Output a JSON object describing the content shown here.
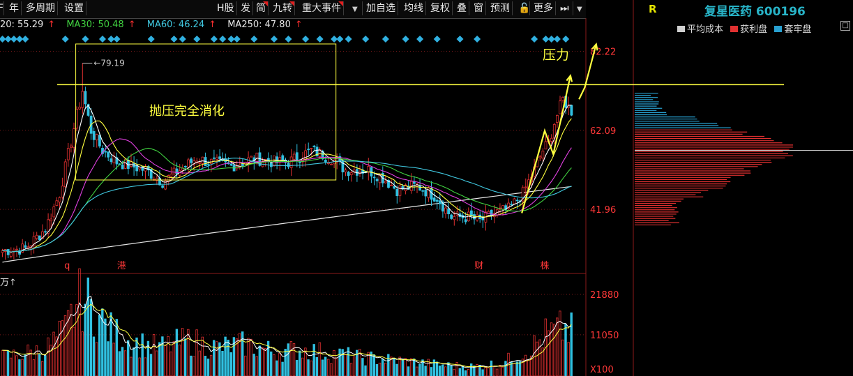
{
  "toolbar": {
    "items": [
      "年",
      "多周期",
      "设置",
      "H股",
      "发",
      "简",
      "九转",
      "重大事件",
      "加自选",
      "均线",
      "复权",
      "叠",
      "窗",
      "预测",
      "更多"
    ],
    "first_fragment": "F"
  },
  "ma_legend": {
    "items": [
      {
        "label": "20: 55.29",
        "color": "#e6e6e6"
      },
      {
        "label": "MA30: 50.48",
        "color": "#40d040"
      },
      {
        "label": "MA60: 46.24",
        "color": "#40c8e0"
      },
      {
        "label": "MA250: 47.80",
        "color": "#e6e6e6"
      }
    ],
    "up_arrow": "↑"
  },
  "volume_label": "万↑",
  "header_right": {
    "r": "R",
    "stock": "复星医药 600196"
  },
  "legend2": {
    "items": [
      {
        "label": "平均成本",
        "color": "#d0d0d0"
      },
      {
        "label": "获利盘",
        "color": "#e03030"
      },
      {
        "label": "套牢盘",
        "color": "#28a0d0"
      }
    ]
  },
  "annotations": {
    "digest": "抛压完全消化",
    "pressure": "压力",
    "peak_label": "79.19"
  },
  "colors": {
    "up": "#e03030",
    "down": "#30c0e0",
    "annot": "#ffff40",
    "axis_text": "#ff3838"
  },
  "chart_data": [
    {
      "type": "line",
      "title": "",
      "price_axis_ticks": [
        82.22,
        62.09,
        41.96
      ],
      "ylim": [
        26.0,
        85.5
      ],
      "bar_count": 200,
      "peak_high": 79.19,
      "pressure_level": 73.7,
      "event_markers": [
        {
          "label": "q",
          "bar": 23
        },
        {
          "label": "港",
          "bar": 42
        },
        {
          "label": "财",
          "bar": 167
        },
        {
          "label": "株",
          "bar": 190
        }
      ],
      "close_anchors": [
        [
          0,
          31.5
        ],
        [
          8,
          32.0
        ],
        [
          15,
          37.0
        ],
        [
          20,
          46.0
        ],
        [
          23,
          56.0
        ],
        [
          26,
          66.0
        ],
        [
          28,
          72.0
        ],
        [
          31,
          62.0
        ],
        [
          35,
          57.0
        ],
        [
          40,
          54.0
        ],
        [
          50,
          52.0
        ],
        [
          56,
          49.0
        ],
        [
          62,
          52.0
        ],
        [
          68,
          55.0
        ],
        [
          72,
          54.0
        ],
        [
          80,
          53.0
        ],
        [
          88,
          55.0
        ],
        [
          95,
          54.0
        ],
        [
          100,
          54.0
        ],
        [
          108,
          57.0
        ],
        [
          115,
          55.0
        ],
        [
          120,
          52.0
        ],
        [
          128,
          52.0
        ],
        [
          133,
          50.0
        ],
        [
          138,
          47.0
        ],
        [
          145,
          48.0
        ],
        [
          152,
          45.0
        ],
        [
          157,
          40.0
        ],
        [
          163,
          40.0
        ],
        [
          167,
          39.0
        ],
        [
          172,
          41.0
        ],
        [
          177,
          42.0
        ],
        [
          182,
          46.0
        ],
        [
          186,
          52.0
        ],
        [
          189,
          57.0
        ],
        [
          191,
          59.0
        ],
        [
          193,
          64.0
        ],
        [
          196,
          70.0
        ],
        [
          199,
          67.0
        ]
      ],
      "series": [
        {
          "name": "MA20",
          "value": 55.29,
          "color": "#e6e6e6"
        },
        {
          "name": "MA30",
          "value": 50.48,
          "color": "#40d040"
        },
        {
          "name": "MA60",
          "value": 46.24,
          "color": "#40c8e0"
        },
        {
          "name": "MA250",
          "value": 47.8,
          "color": "#e6e6e6"
        }
      ]
    },
    {
      "type": "bar",
      "title": "",
      "volume_axis_ticks": [
        21880,
        11050
      ],
      "axis_unit": "X100",
      "ylim": [
        0,
        26000
      ],
      "volume_anchors": [
        [
          0,
          5000
        ],
        [
          15,
          7000
        ],
        [
          22,
          12000
        ],
        [
          26,
          19000
        ],
        [
          28,
          21000
        ],
        [
          32,
          17000
        ],
        [
          38,
          12000
        ],
        [
          45,
          9000
        ],
        [
          55,
          7500
        ],
        [
          65,
          9500
        ],
        [
          75,
          7500
        ],
        [
          85,
          8500
        ],
        [
          95,
          6500
        ],
        [
          105,
          7000
        ],
        [
          115,
          6000
        ],
        [
          125,
          5000
        ],
        [
          140,
          4000
        ],
        [
          155,
          2800
        ],
        [
          165,
          2500
        ],
        [
          175,
          3500
        ],
        [
          185,
          7500
        ],
        [
          190,
          11000
        ],
        [
          196,
          12500
        ],
        [
          199,
          11800
        ]
      ]
    },
    {
      "type": "bar",
      "title": "",
      "orientation": "horizontal",
      "avg_cost": 57.0,
      "current_close": 67.0,
      "price_range": [
        38.0,
        72.0
      ]
    }
  ]
}
